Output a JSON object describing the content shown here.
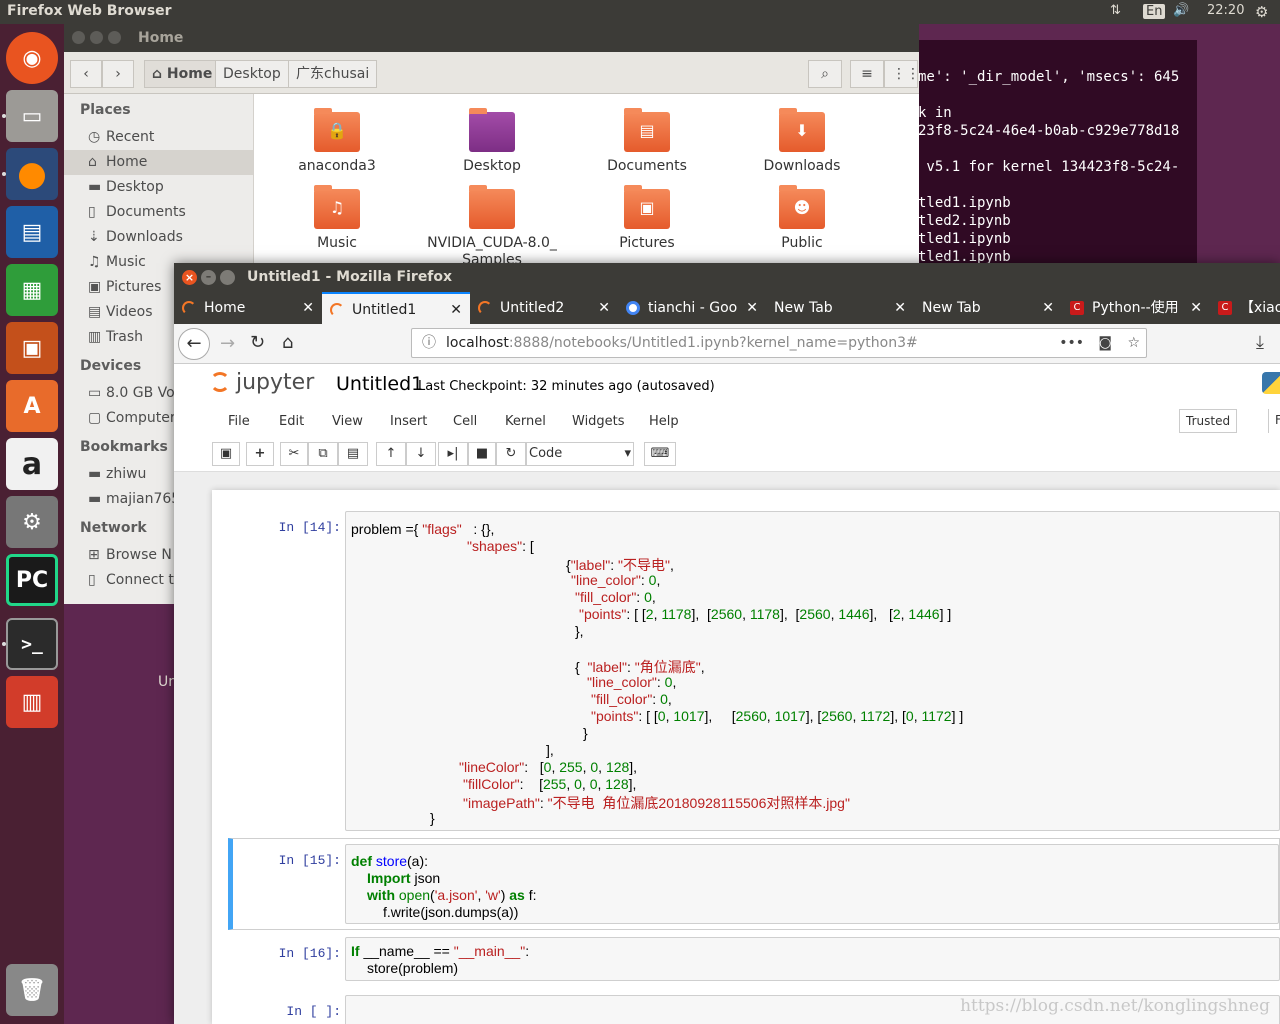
{
  "topbar": {
    "title": "Firefox Web Browser",
    "lang": "En",
    "time": "22:20"
  },
  "launcher": [
    "ubuntu-dash",
    "files",
    "firefox",
    "writer",
    "calc",
    "impress",
    "software-center",
    "amazon",
    "system-settings",
    "pycharm",
    "terminal",
    "system-monitor",
    "trash"
  ],
  "terminal": {
    "lines": [
      "me': '_dir_model', 'msecs': 645",
      "k in",
      "23f8-5c24-46e4-b0ab-c929e778d18",
      " v5.1 for kernel 134423f8-5c24-",
      "tled1.ipynb",
      "tled2.ipynb",
      "tled1.ipynb",
      "tled1.ipynb"
    ]
  },
  "nautilus": {
    "title": "Home",
    "breadcrumbs": [
      "Home",
      "Desktop",
      "广东chusai"
    ],
    "places_header": "Places",
    "places": [
      {
        "label": "Recent",
        "icon": "clock-icon"
      },
      {
        "label": "Home",
        "icon": "home-icon"
      },
      {
        "label": "Desktop",
        "icon": "folder-icon"
      },
      {
        "label": "Documents",
        "icon": "document-icon"
      },
      {
        "label": "Downloads",
        "icon": "download-icon"
      },
      {
        "label": "Music",
        "icon": "music-icon"
      },
      {
        "label": "Pictures",
        "icon": "camera-icon"
      },
      {
        "label": "Videos",
        "icon": "film-icon"
      },
      {
        "label": "Trash",
        "icon": "trash-icon"
      }
    ],
    "devices_header": "Devices",
    "devices": [
      "8.0 GB Vol",
      "Computer"
    ],
    "bookmarks_header": "Bookmarks",
    "bookmarks": [
      "zhiwu",
      "majian765"
    ],
    "network_header": "Network",
    "network": [
      "Browse N",
      "Connect t"
    ],
    "files": [
      {
        "label": "anaconda3",
        "emblem": "🔒"
      },
      {
        "label": "Desktop",
        "emblem": ""
      },
      {
        "label": "Documents",
        "emblem": "▤"
      },
      {
        "label": "Downloads",
        "emblem": "⬇"
      },
      {
        "label": "Music",
        "emblem": "♫"
      },
      {
        "label": "NVIDIA_CUDA-8.0_ Samples",
        "emblem": ""
      },
      {
        "label": "Pictures",
        "emblem": "▣"
      },
      {
        "label": "Public",
        "emblem": "☻"
      }
    ],
    "desktop_label": "Un"
  },
  "firefox": {
    "title": "Untitled1 - Mozilla Firefox",
    "tabs": [
      "Home",
      "Untitled1",
      "Untitled2",
      "tianchi - Goo",
      "New Tab",
      "New Tab",
      "Python--使用",
      "【xiao"
    ],
    "url_host": "localhost",
    "url_path": ":8888/notebooks/Untitled1.ipynb?kernel_name=python3#"
  },
  "jupyter": {
    "logo": "jupyter",
    "notebook_name": "Untitled1",
    "checkpoint": "Last Checkpoint: 32 minutes ago (autosaved)",
    "menu": [
      "File",
      "Edit",
      "View",
      "Insert",
      "Cell",
      "Kernel",
      "Widgets",
      "Help"
    ],
    "trusted": "Trusted",
    "kernel_partial": "F",
    "cell_type": "Code",
    "prompts": [
      "In [14]:",
      "In [15]:",
      "In [16]:",
      "In [ ]:"
    ],
    "cell14": {
      "l1a": "problem ={ ",
      "l1b": "\"flags\"",
      "l1c": "   : {},",
      "l2a": "\"shapes\"",
      "l2b": ": [",
      "l3a": "{",
      "l3b": "\"label\"",
      "l3c": ": ",
      "l3d": "\"不导电\"",
      "l3e": ",",
      "l4a": "\"line_color\"",
      "l4b": ": ",
      "l4c": "0",
      "l5a": "\"fill_color\"",
      "l5b": ": ",
      "l5c": "0",
      "l6a": "\"points\"",
      "l6b": ": [ [",
      "l6c": "2",
      "l6d": ", ",
      "l6e": "1178",
      "l6f": "],  [",
      "l6g": "2560",
      "l6h": ", ",
      "l6i": "1178",
      "l6j": "],  [",
      "l6k": "2560",
      "l6l": ", ",
      "l6m": "1446",
      "l6n": "],   [",
      "l6o": "2",
      "l6p": ", ",
      "l6q": "1446",
      "l6r": "] ]",
      "l7": "},",
      "l8a": "{  ",
      "l8b": "\"label\"",
      "l8c": ": ",
      "l8d": "\"角位漏底\"",
      "l8e": ",",
      "l9a": "\"line_color\"",
      "l9b": ": ",
      "l9c": "0",
      "l10a": "\"fill_color\"",
      "l10b": ": ",
      "l10c": "0",
      "l11a": "\"points\"",
      "l11b": ": [ [",
      "l11c": "0",
      "l11d": ", ",
      "l11e": "1017",
      "l11f": "],     [",
      "l11g": "2560",
      "l11h": ", ",
      "l11i": "1017",
      "l11j": "], [",
      "l11k": "2560",
      "l11l": ", ",
      "l11m": "1172",
      "l11n": "], [",
      "l11o": "0",
      "l11p": ", ",
      "l11q": "1172",
      "l11r": "] ]",
      "l12": "}",
      "l13": "],",
      "l14a": "\"lineColor\"",
      "l14b": ":   [",
      "l14c": "0",
      "l14d": ", ",
      "l14e": "255",
      "l14f": ", ",
      "l14g": "0",
      "l14h": ", ",
      "l14i": "128",
      "l14j": "],",
      "l15a": "\"fillColor\"",
      "l15b": ":    [",
      "l15c": "255",
      "l15d": ", ",
      "l15e": "0",
      "l15f": ", ",
      "l15g": "0",
      "l15h": ", ",
      "l15i": "128",
      "l15j": "],",
      "l16a": "\"imagePath\"",
      "l16b": ": ",
      "l16c": "\"不导电  角位漏底20180928115506对照样本.jpg\"",
      "l17": "}"
    },
    "cell15": {
      "l1a": "def ",
      "l1b": "store",
      "l1c": "(a):",
      "l2a": "Import ",
      "l2b": "json",
      "l3a": "with ",
      "l3b": "open",
      "l3c": "(",
      "l3d": "'a.json'",
      "l3e": ", ",
      "l3f": "'w'",
      "l3g": ") ",
      "l3h": "as",
      "l3i": " f:",
      "l4": "f.write(json.dumps(a))"
    },
    "cell16": {
      "l1a": "If ",
      "l1b": "__name__ == ",
      "l1c": "\"__main__\"",
      "l1d": ":",
      "l2": "store(problem)"
    }
  },
  "watermark": "https://blog.csdn.net/konglingshneg"
}
